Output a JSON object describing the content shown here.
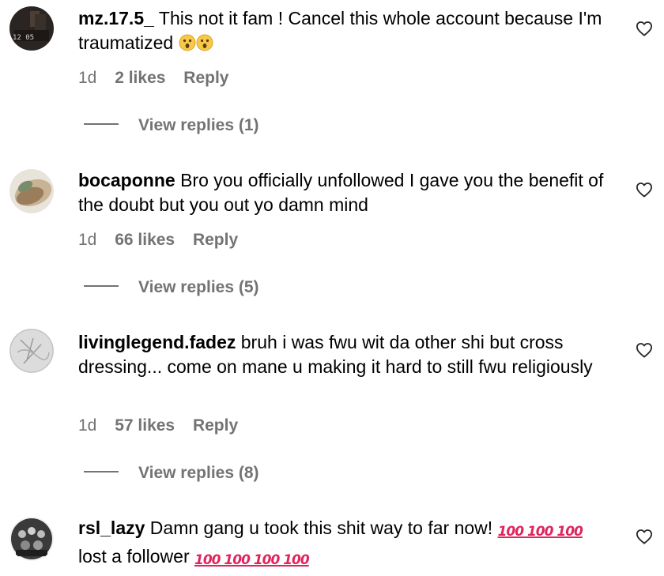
{
  "comments": [
    {
      "username": "mz.17.5_",
      "text": "This not it fam ! Cancel this whole account because I'm traumatized",
      "emoji": [
        "astonished-face-emoji",
        "astonished-face-emoji"
      ],
      "age": "1d",
      "likes": "2 likes",
      "reply_label": "Reply",
      "view_replies": "View replies (1)",
      "avatar_text": "12 05"
    },
    {
      "username": "bocaponne",
      "text": "Bro you officially unfollowed I gave you the benefit of the doubt but you out yo damn mind",
      "age": "1d",
      "likes": "66 likes",
      "reply_label": "Reply",
      "view_replies": "View replies (5)"
    },
    {
      "username": "livinglegend.fadez",
      "text": "bruh i was fwu wit da other shi but cross dressing... come on mane u making it hard to still fwu religiously",
      "age": "1d",
      "likes": "57 likes",
      "reply_label": "Reply",
      "view_replies": "View replies (8)"
    },
    {
      "username": "rsl_lazy",
      "text_part1": "Damn gang u took this shit way to far now!",
      "hundreds_1": "100 100 100",
      "text_part2": "lost a follower",
      "hundreds_2": "100 100 100 100"
    }
  ],
  "colors": {
    "text": "#000000",
    "meta": "#737373",
    "hundred": "#e0245e",
    "emoji": "#f7c948"
  }
}
